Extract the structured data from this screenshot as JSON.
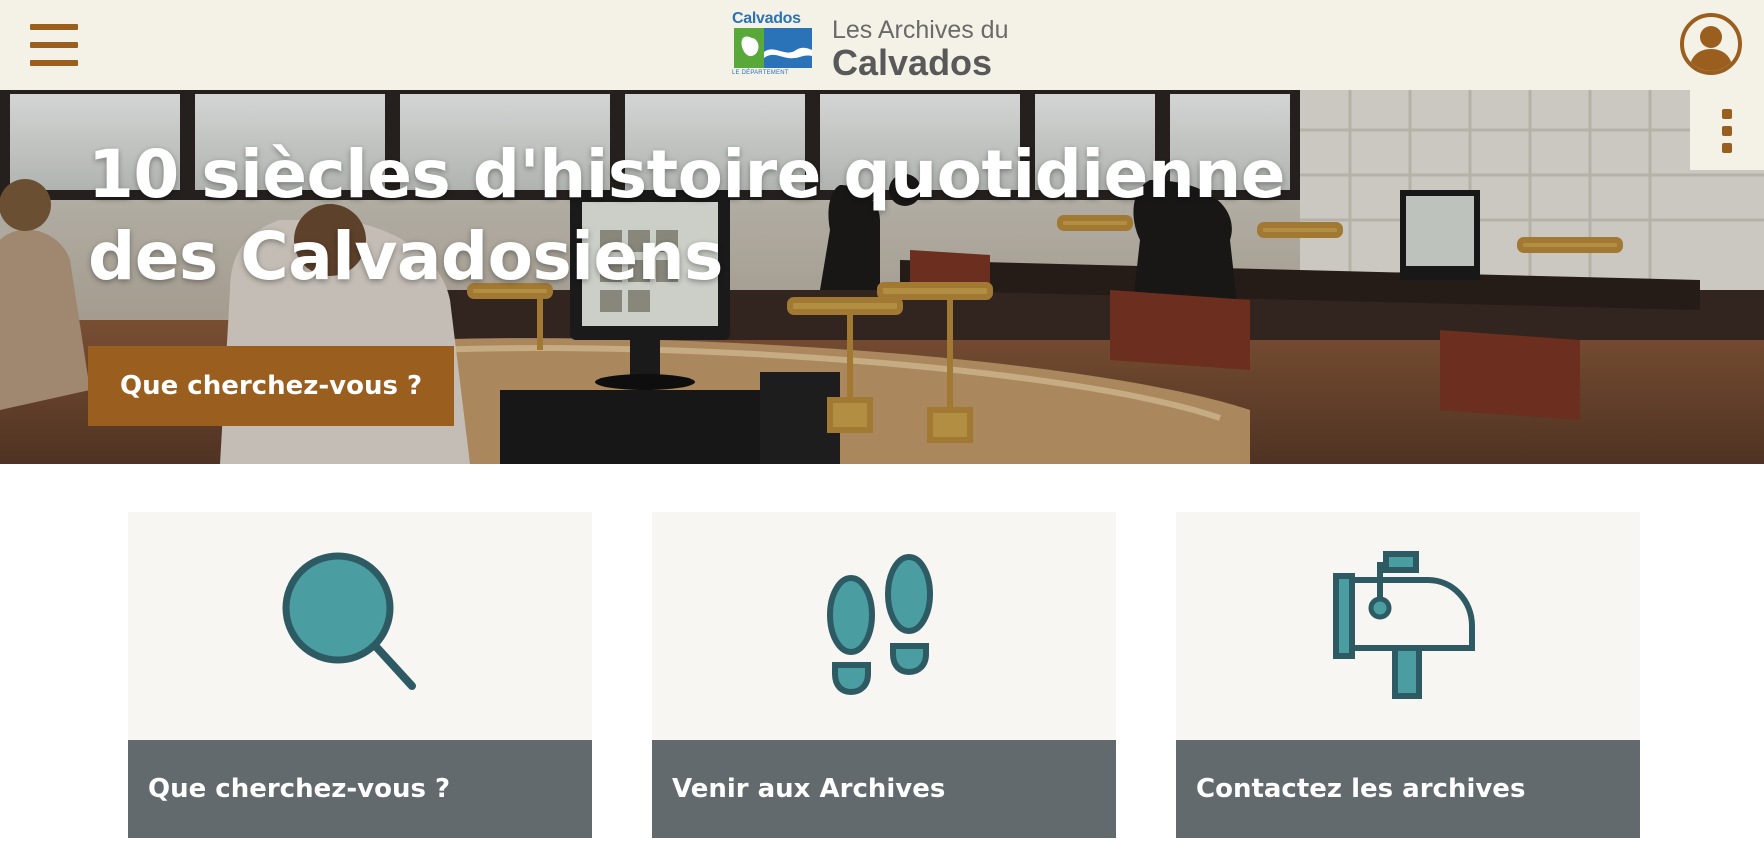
{
  "header": {
    "menu_icon": "hamburger-menu-icon",
    "logo": {
      "badge_word": "Calvados",
      "badge_sub": "LE DÉPARTEMENT",
      "line1": "Les Archives du",
      "line2": "Calvados"
    },
    "account_icon": "user-account-icon"
  },
  "hero": {
    "title": "10 siècles d'histoire quotidienne des Calvadosiens",
    "button_label": "Que cherchez-vous ?",
    "side_menu_icon": "vertical-dots-icon"
  },
  "cards": [
    {
      "label": "Que cherchez-vous ?",
      "icon": "magnifier-icon"
    },
    {
      "label": "Venir aux Archives",
      "icon": "footprints-icon"
    },
    {
      "label": "Contactez les archives",
      "icon": "mailbox-icon"
    }
  ],
  "colors": {
    "brand_brown": "#9a5f1f",
    "header_bg": "#f4f1e7",
    "card_bg": "#f7f6f2",
    "card_label_bg": "#636a6e",
    "icon_teal": "#4a9da0",
    "icon_outline": "#2d5a63"
  }
}
